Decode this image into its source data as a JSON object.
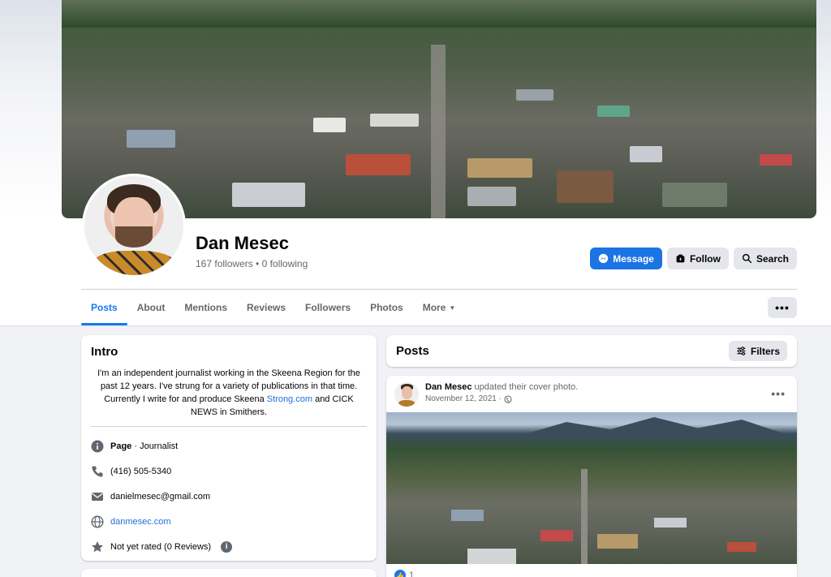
{
  "profile": {
    "name": "Dan Mesec",
    "stats": "167 followers • 0 following"
  },
  "actions": {
    "message": "Message",
    "follow": "Follow",
    "search": "Search"
  },
  "tabs": [
    {
      "label": "Posts",
      "active": true
    },
    {
      "label": "About"
    },
    {
      "label": "Mentions"
    },
    {
      "label": "Reviews"
    },
    {
      "label": "Followers"
    },
    {
      "label": "Photos"
    },
    {
      "label": "More"
    }
  ],
  "more_button": "•••",
  "intro": {
    "title": "Intro",
    "bio_part1": "I'm an independent journalist working in the Skeena Region for the past 12 years. I've strung for a variety of publications in that time. Currently I write for and produce Skeena ",
    "bio_link": "Strong.com",
    "bio_part2": " and CICK NEWS in Smithers.",
    "page_label": "Page",
    "page_category": " · Journalist",
    "phone": "(416) 505-5340",
    "email": "danielmesec@gmail.com",
    "website": "danmesec.com",
    "rating": "Not yet rated (0 Reviews)"
  },
  "posts_header": {
    "title": "Posts",
    "filters": "Filters"
  },
  "post": {
    "author": "Dan Mesec",
    "action": " updated their cover photo.",
    "date": "November 12, 2021 ·",
    "more": "•••",
    "like_count": "1"
  },
  "colors": {
    "accent": "#1877f2",
    "primary_button": "#1b74e4",
    "secondary_button": "#e4e6eb",
    "page_bg": "#f0f2f5"
  }
}
